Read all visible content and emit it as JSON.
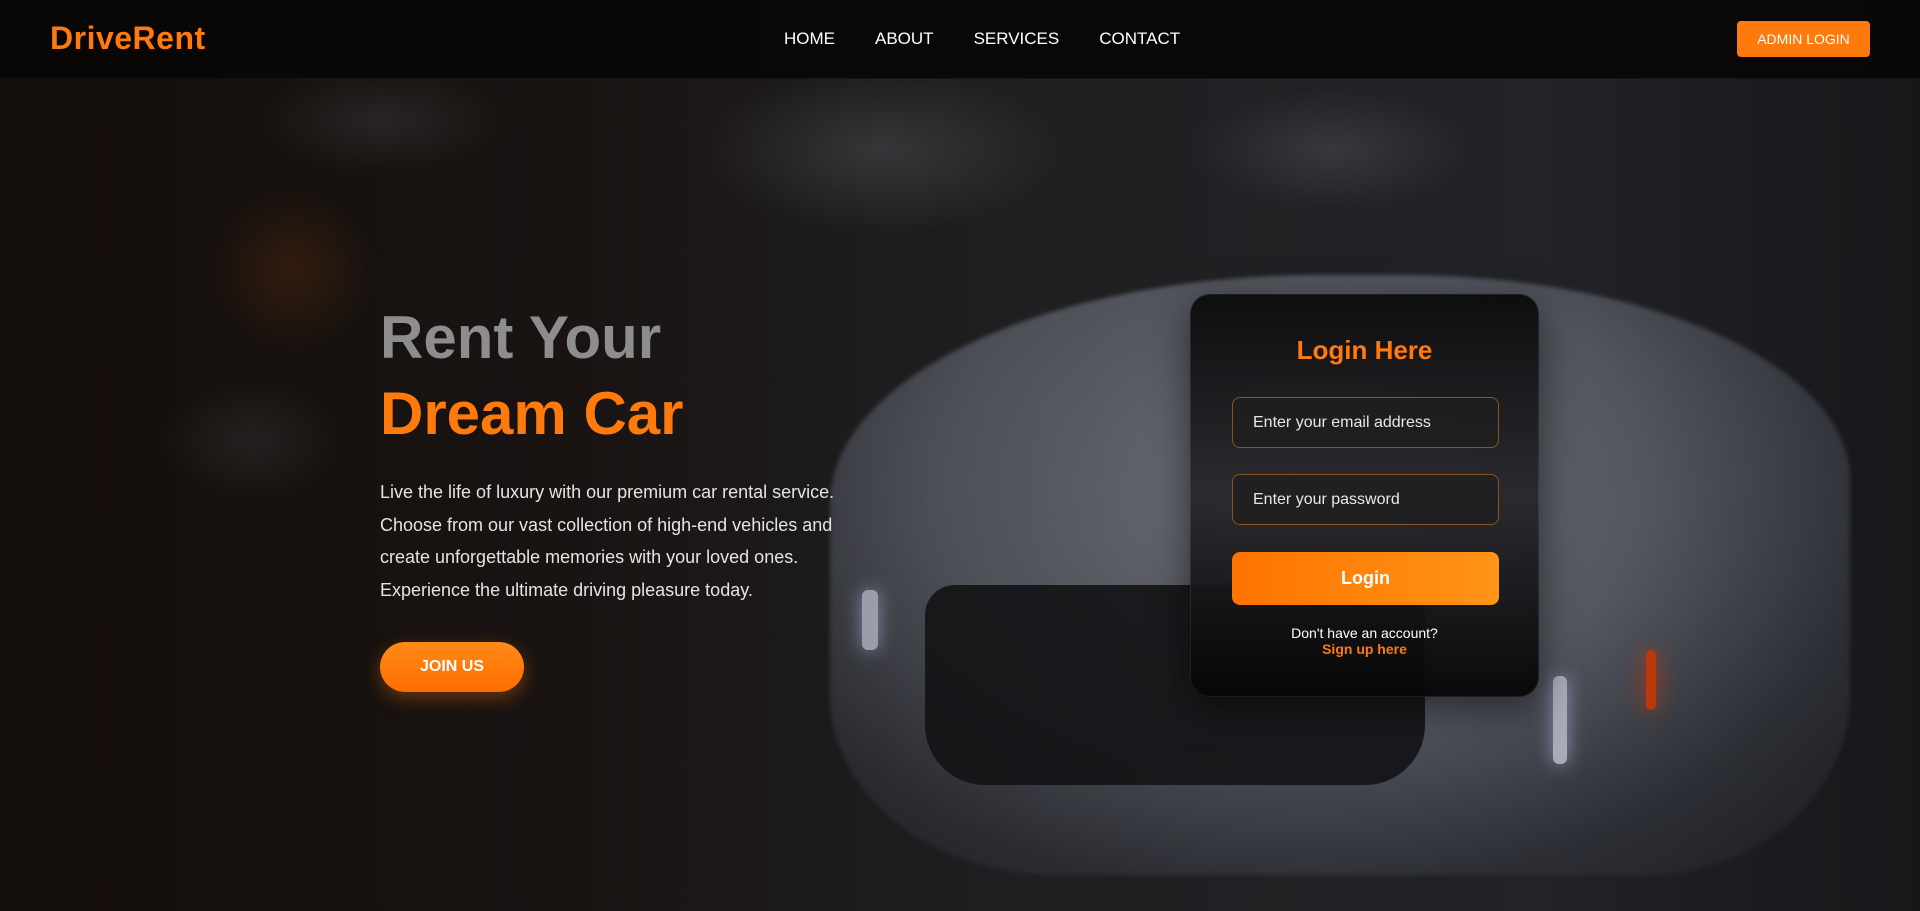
{
  "brand": {
    "name": "DriveRent",
    "accent_color": "#ff7a0c"
  },
  "nav": {
    "links": [
      {
        "label": "HOME"
      },
      {
        "label": "ABOUT"
      },
      {
        "label": "SERVICES"
      },
      {
        "label": "CONTACT"
      }
    ],
    "admin_button": "ADMIN LOGIN"
  },
  "hero": {
    "title_line1": "Rent Your",
    "title_line2": "Dream Car",
    "description": "Live the life of luxury with our premium car rental service. Choose from our vast collection of high-end vehicles and create unforgettable memories with your loved ones. Experience the ultimate driving pleasure today.",
    "cta": "JOIN US"
  },
  "login": {
    "title": "Login Here",
    "email_placeholder": "Enter your email address",
    "password_placeholder": "Enter your password",
    "submit": "Login",
    "signup_prompt": "Don't have an account?",
    "signup_link": "Sign up here"
  }
}
